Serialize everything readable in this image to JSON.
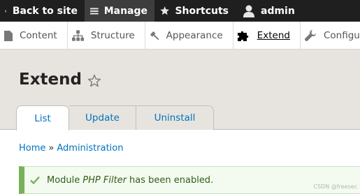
{
  "toolbar": {
    "back": "Back to site",
    "manage": "Manage",
    "shortcuts": "Shortcuts",
    "user": "admin"
  },
  "tray": {
    "content": "Content",
    "structure": "Structure",
    "appearance": "Appearance",
    "extend": "Extend",
    "configuration": "Configu"
  },
  "page": {
    "title": "Extend"
  },
  "tabs": {
    "list": "List",
    "update": "Update",
    "uninstall": "Uninstall"
  },
  "breadcrumb": {
    "home": "Home",
    "separator": "»",
    "administration": "Administration"
  },
  "status": {
    "prefix": "Module",
    "module_name": "PHP Filter",
    "suffix": "has been enabled."
  },
  "watermark": "CSDN @freesec",
  "colors": {
    "toolbar": "#1f1f1f",
    "header_bg": "#e7e4df",
    "link": "#0074bd",
    "status_accent": "#77b259"
  },
  "icons": {
    "back": "chevron-left-icon",
    "manage": "hamburger-icon",
    "shortcuts": "star-icon",
    "user": "person-icon",
    "content": "file-icon",
    "structure": "sitemap-icon",
    "appearance": "brush-icon",
    "extend": "puzzle-icon",
    "configuration": "wrench-icon",
    "favorite": "star-outline-icon",
    "status": "checkmark-icon"
  }
}
